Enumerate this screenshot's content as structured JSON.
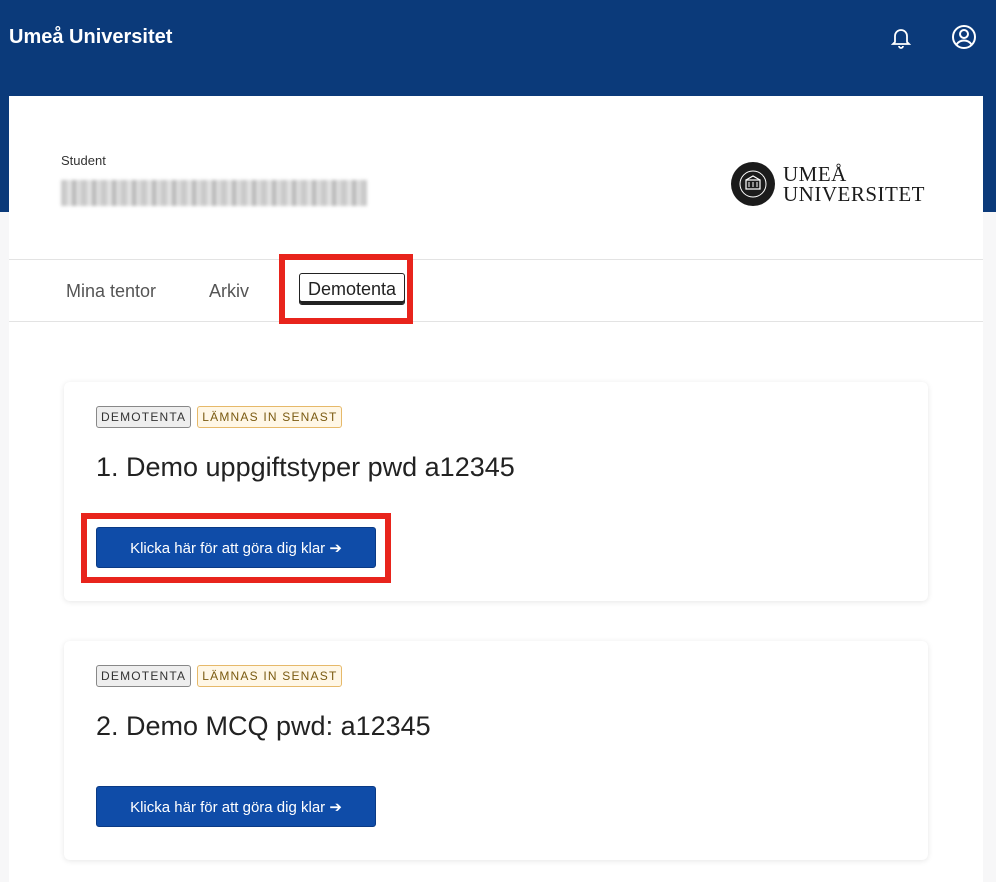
{
  "header": {
    "brand": "Umeå Universitet",
    "bell_icon": "bell-icon",
    "user_icon": "user-circle-icon",
    "bg_color": "#0b3a7a"
  },
  "student": {
    "label": "Student",
    "name": "(blurred)"
  },
  "logo": {
    "line1": "UMEÅ",
    "line2": "UNIVERSITET"
  },
  "tabs": [
    {
      "label": "Mina tentor"
    },
    {
      "label": "Arkiv"
    },
    {
      "label": "Demotenta",
      "active": true
    }
  ],
  "exams": [
    {
      "badge1": "DEMOTENTA",
      "badge2": "LÄMNAS IN SENAST",
      "title": "1. Demo uppgiftstyper pwd a12345",
      "button": "Klicka här för att göra dig klar ➔"
    },
    {
      "badge1": "DEMOTENTA",
      "badge2": "LÄMNAS IN SENAST",
      "title": "2. Demo MCQ pwd: a12345",
      "button": "Klicka här för att göra dig klar ➔"
    }
  ],
  "colors": {
    "primary_button": "#0f4ca8",
    "highlight": "#e8241c"
  }
}
